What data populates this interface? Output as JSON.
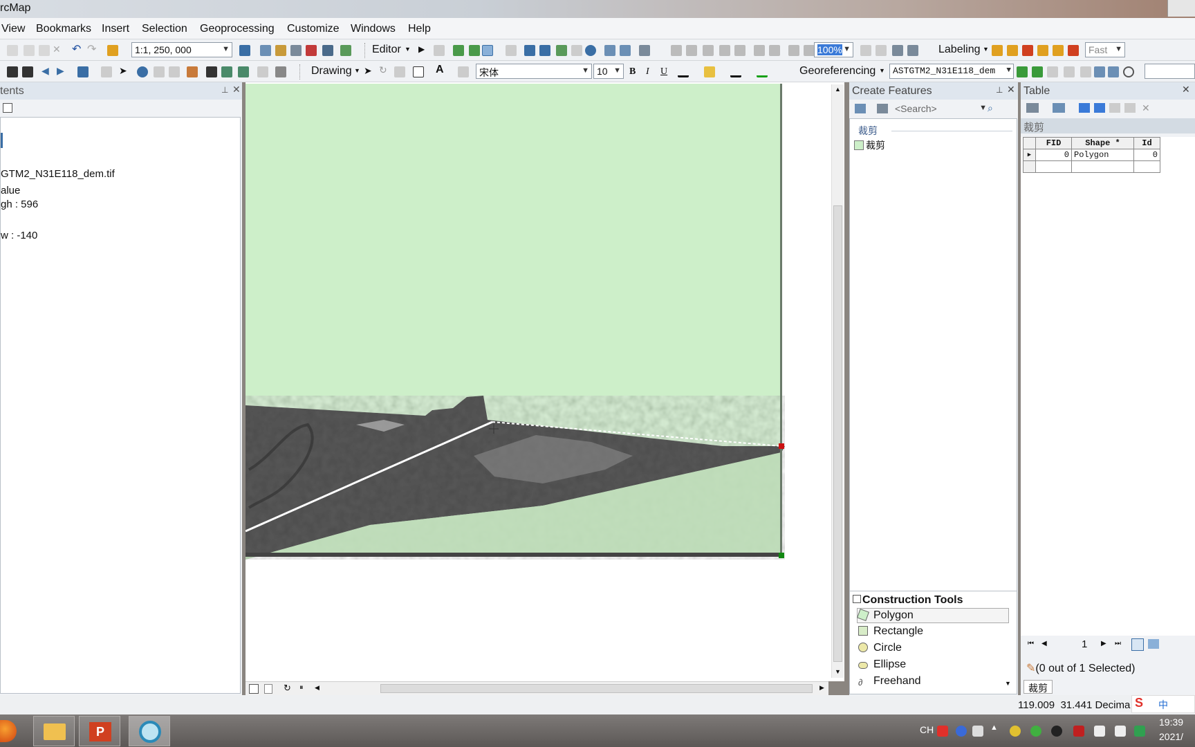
{
  "window": {
    "title": "rcMap"
  },
  "menu": [
    "View",
    "Bookmarks",
    "Insert",
    "Selection",
    "Geoprocessing",
    "Customize",
    "Windows",
    "Help"
  ],
  "toolbar1": {
    "scale": "1:1, 250, 000",
    "editor_label": "Editor",
    "zoom_value": "100%",
    "labeling_label": "Labeling",
    "fast_label": "Fast"
  },
  "toolbar2": {
    "drawing_label": "Drawing",
    "font_name": "宋体",
    "font_size": "10",
    "bold": "B",
    "italic": "I",
    "underline": "U",
    "georef_label": "Georeferencing",
    "georef_layer": "ASTGTM2_N31E118_dem"
  },
  "toc": {
    "title": "tents",
    "lines": [
      "GTM2_N31E118_dem.tif",
      "alue",
      "gh : 596",
      "w : -140"
    ]
  },
  "create_features": {
    "title": "Create Features",
    "search_placeholder": "<Search>",
    "group": "裁剪",
    "template": "裁剪",
    "construction_title": "Construction Tools",
    "tools": [
      "Polygon",
      "Rectangle",
      "Circle",
      "Ellipse",
      "Freehand"
    ]
  },
  "table_window": {
    "title": "Table",
    "tab_name": "裁剪",
    "columns": [
      "FID",
      "Shape *",
      "Id"
    ],
    "rows": [
      [
        "0",
        "Polygon",
        "0"
      ]
    ],
    "record_number": "1",
    "selection_status": "(0 out of 1 Selected)",
    "bottom_tab": "裁剪"
  },
  "status_bar": {
    "coordinates": "119.009  31.441 Decima"
  },
  "taskbar": {
    "tray_lang": "CH",
    "time": "19:39",
    "date": "2021/",
    "ime": "中"
  },
  "colors": {
    "map_polygon_fill": "#cdefc9",
    "raster_dark": "#555555",
    "vertex_red": "#cc1111",
    "vertex_green": "#118811"
  }
}
